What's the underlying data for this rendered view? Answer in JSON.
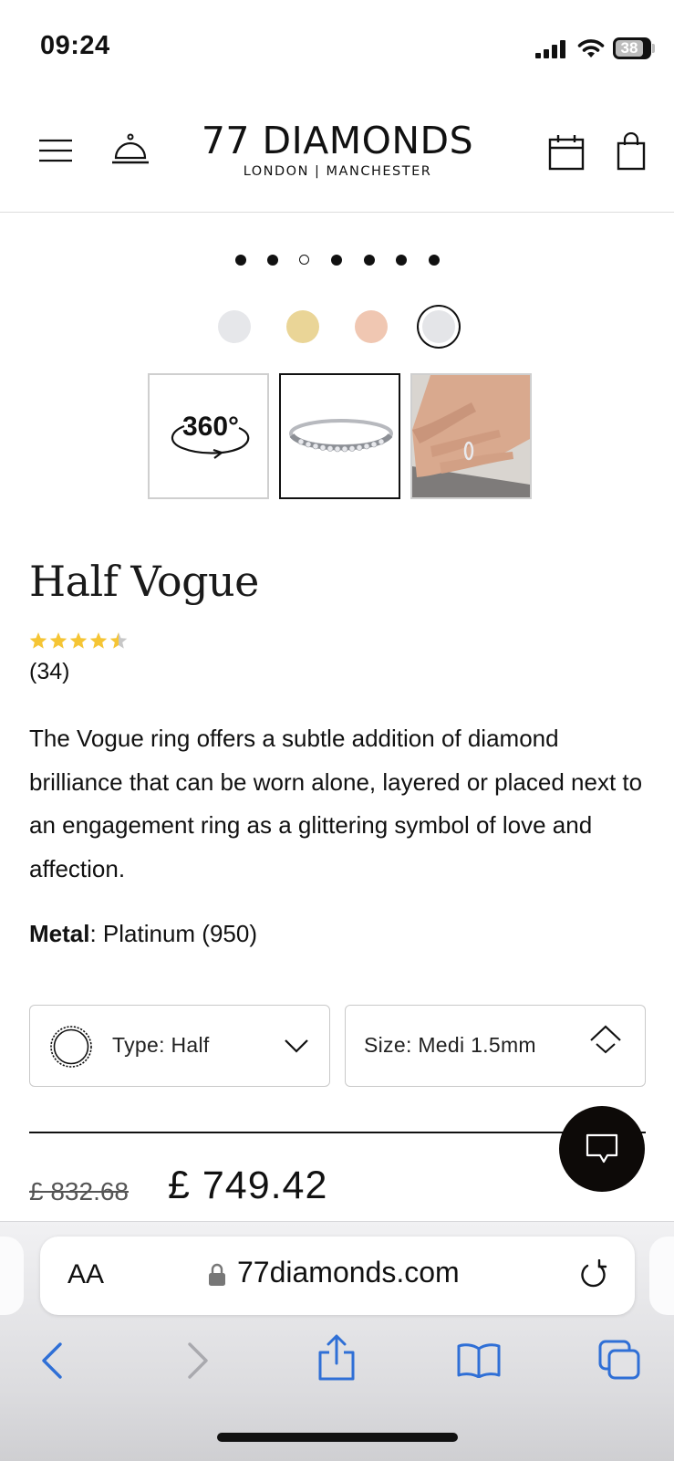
{
  "status_bar": {
    "time": "09:24",
    "battery": "38"
  },
  "header": {
    "brand_name": "77 DIAMONDS",
    "brand_subtitle": "LONDON | MANCHESTER",
    "icons": [
      "menu-icon",
      "concierge-bell-icon",
      "calendar-icon",
      "shopping-bag-icon"
    ]
  },
  "gallery": {
    "dot_count": 7,
    "active_dot": 3,
    "metal_swatches": [
      {
        "name": "white-gold",
        "color": "#e6e7ea"
      },
      {
        "name": "yellow-gold",
        "color": "#ead597"
      },
      {
        "name": "rose-gold",
        "color": "#f0c7b2"
      },
      {
        "name": "platinum",
        "color": "#e4e5e8",
        "selected": true
      }
    ],
    "thumbnails": [
      {
        "type": "360-view",
        "label": "360°"
      },
      {
        "type": "ring-image",
        "selected": true
      },
      {
        "type": "hand-image"
      }
    ]
  },
  "product": {
    "title": "Half Vogue",
    "rating": 4.5,
    "review_count": "(34)",
    "description": "The Vogue ring offers a subtle addition of diamond brilliance that can be worn alone, layered or placed next to an engagement ring as a glittering symbol of love and affection.",
    "metal_label": "Metal",
    "metal_value": ": Platinum (950)"
  },
  "options": {
    "type_select": "Type:  Half",
    "size_select": "Size:  Medi 1.5mm"
  },
  "price": {
    "old": "£ 832.68",
    "new": "£ 749.42"
  },
  "browser": {
    "aa_label": "AA",
    "url": "77diamonds.com"
  },
  "colors": {
    "star": "#f5c535",
    "link_blue": "#2f6fd6",
    "chat_bg": "#0d0a08"
  }
}
